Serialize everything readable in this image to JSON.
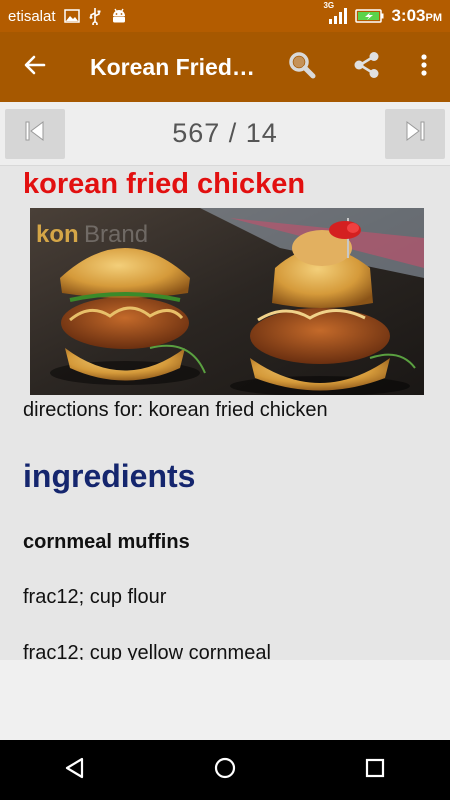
{
  "status_bar": {
    "carrier": "etisalat",
    "network": "3G",
    "time": "3:03",
    "ampm": "PM",
    "icons": [
      "image-icon",
      "usb-icon",
      "android-debug-icon",
      "signal-icon",
      "battery-charging-icon"
    ]
  },
  "app_bar": {
    "title": "Korean Fried…",
    "icons": [
      "back-arrow-icon",
      "search-icon",
      "share-icon",
      "more-vert-icon"
    ]
  },
  "pager": {
    "count": "567 / 14",
    "icons": [
      "skip-previous-icon",
      "skip-next-icon"
    ]
  },
  "recipe": {
    "title": "korean fried chicken",
    "image_watermark": "konBrand",
    "directions": "directions for: korean fried chicken",
    "ingredients_heading": "ingredients",
    "section_title": "cornmeal muffins",
    "ingredients": [
      "frac12; cup flour",
      "frac12; cup yellow cornmeal"
    ]
  },
  "nav_bar": {
    "icons": [
      "back-triangle-icon",
      "home-circle-icon",
      "recents-square-icon"
    ]
  },
  "colors": {
    "status_bar": "#b35c00",
    "app_bar": "#a65800",
    "title_red": "#e21010",
    "heading_navy": "#15266e"
  }
}
